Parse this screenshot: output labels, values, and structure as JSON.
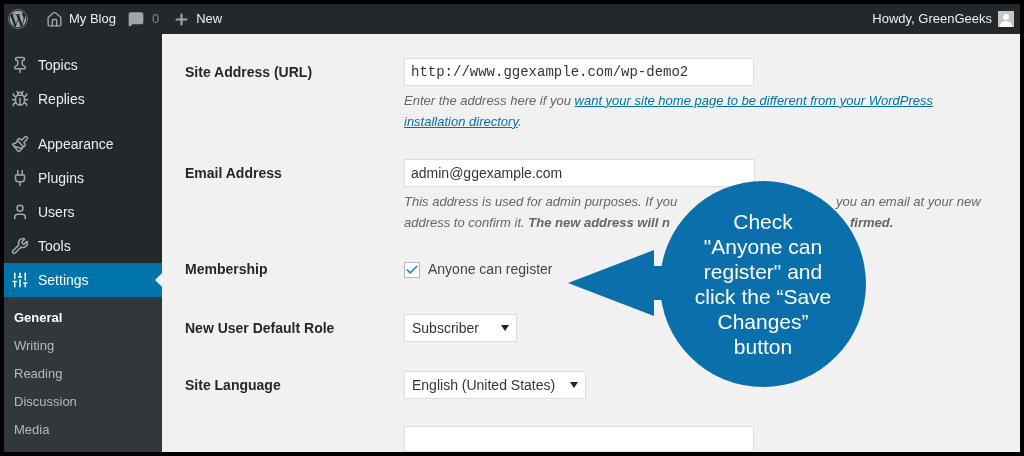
{
  "top_bar": {
    "site": "My Blog",
    "comments": "0",
    "new": "New",
    "greeting": "Howdy, GreenGeeks"
  },
  "sidebar": {
    "items": [
      {
        "label": "Topics",
        "selected": false
      },
      {
        "label": "Replies",
        "selected": false
      },
      {
        "label": "Appearance",
        "selected": false
      },
      {
        "label": "Plugins",
        "selected": false
      },
      {
        "label": "Users",
        "selected": false
      },
      {
        "label": "Tools",
        "selected": false
      },
      {
        "label": "Settings",
        "selected": true
      }
    ],
    "submenu": [
      {
        "label": "General",
        "selected": true
      },
      {
        "label": "Writing",
        "selected": false
      },
      {
        "label": "Reading",
        "selected": false
      },
      {
        "label": "Discussion",
        "selected": false
      },
      {
        "label": "Media",
        "selected": false
      }
    ]
  },
  "form": {
    "rows": [
      {
        "kind": "text",
        "label": "Site Address (URL)",
        "value": "http://www.ggexample.com/wp-demo2",
        "description": [
          {
            "left": [
              {
                "kind": "text",
                "text": "Enter the address here if you "
              },
              {
                "kind": "link",
                "text": "want your site home page to be different from your WordPress"
              }
            ]
          },
          {
            "left": [
              {
                "kind": "link",
                "text": "installation directory"
              },
              {
                "kind": "text",
                "text": "."
              }
            ]
          }
        ]
      },
      {
        "kind": "text",
        "label": "Email Address",
        "value": "admin@ggexample.com",
        "description": [
          {
            "left": [
              {
                "kind": "text",
                "text": "This address is used for admin purposes. If you"
              }
            ],
            "right": [
              {
                "kind": "text",
                "text": "you an email at your new"
              }
            ]
          },
          {
            "left": [
              {
                "kind": "text",
                "text": "address to confirm it. "
              },
              {
                "kind": "bold",
                "text": "The new address will n"
              }
            ],
            "right": [
              {
                "kind": "bold",
                "text": "firmed."
              }
            ]
          }
        ]
      },
      {
        "kind": "checkbox",
        "label": "Membership",
        "option": "Anyone can register",
        "checked": true
      },
      {
        "kind": "select",
        "label": "New User Default Role",
        "value": "Subscriber"
      },
      {
        "kind": "select",
        "label": "Site Language",
        "value": "English (United States)"
      }
    ]
  },
  "callout": {
    "text": "Check \"Anyone can register\" and click the “Save Changes” button"
  }
}
